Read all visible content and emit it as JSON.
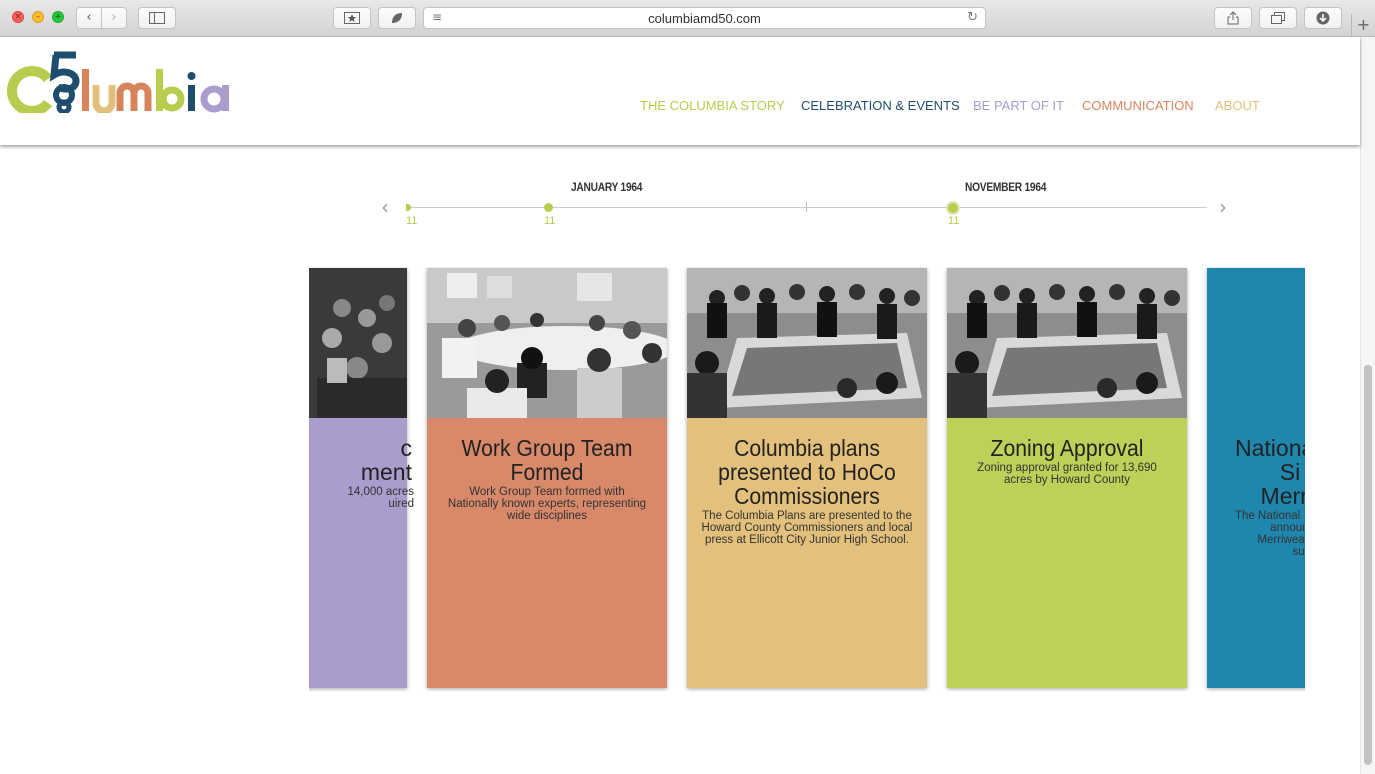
{
  "browser": {
    "url": "columbiamd50.com",
    "back_glyph": "‹",
    "forward_glyph": "›",
    "reload_glyph": "↻",
    "new_tab_glyph": "+"
  },
  "nav": {
    "items": [
      {
        "label": "THE COLUMBIA STORY",
        "color": "#b6cd4e"
      },
      {
        "label": "CELEBRATION & EVENTS",
        "color": "#1e4d6e"
      },
      {
        "label": "BE PART OF IT",
        "color": "#aa9ccc"
      },
      {
        "label": "COMMUNICATION",
        "color": "#d7845c"
      },
      {
        "label": "ABOUT",
        "color": "#e2c07c"
      }
    ]
  },
  "logo": {
    "text": "Columbia",
    "number": "50"
  },
  "timeline": {
    "dates": [
      "JANUARY 1964",
      "NOVEMBER 1964"
    ],
    "markers": [
      "11",
      "11",
      "11"
    ],
    "prev_glyph": "‹",
    "next_glyph": "›"
  },
  "cards": [
    {
      "title": "c\nment",
      "desc": "14,000 acres\nuired",
      "color": "#aa9ccc"
    },
    {
      "title": "Work Group Team Formed",
      "desc": "Work Group Team formed with Nationally known experts, representing wide disciplines",
      "color": "#d7896a"
    },
    {
      "title": "Columbia plans presented to HoCo Commissioners",
      "desc": "The Columbia Plans are presented to the Howard County Commissioners and local press at Ellicott City Junior High School.",
      "color": "#e3c07c"
    },
    {
      "title": "Zoning Approval",
      "desc": "Zoning approval granted for 13,690 acres by Howard County",
      "color": "#bcd158"
    },
    {
      "title": "Nationa\nSi\nMerr",
      "desc": "The National\nannounc\nMerriweath\nsu",
      "color": "#1f86ad"
    }
  ]
}
